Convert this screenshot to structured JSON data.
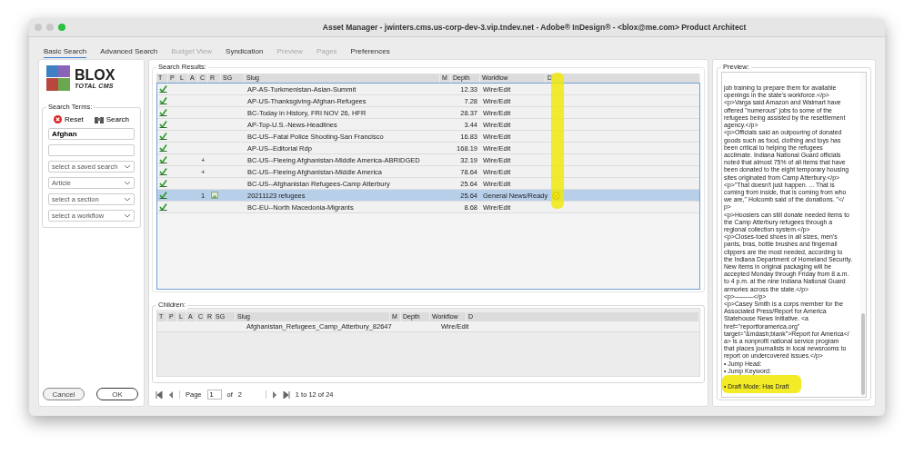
{
  "window": {
    "title": "Asset Manager - jwinters.cms.us-corp-dev-3.vip.tndev.net - Adobe® InDesign® - <blox@me.com> Product Architect"
  },
  "tabs": [
    {
      "label": "Basic Search",
      "selected": true,
      "disabled": false
    },
    {
      "label": "Advanced Search",
      "selected": false,
      "disabled": false
    },
    {
      "label": "Budget View",
      "selected": false,
      "disabled": true
    },
    {
      "label": "Syndication",
      "selected": false,
      "disabled": false
    },
    {
      "label": "Preview",
      "selected": false,
      "disabled": true
    },
    {
      "label": "Pages",
      "selected": false,
      "disabled": true
    },
    {
      "label": "Preferences",
      "selected": false,
      "disabled": false
    }
  ],
  "logo": {
    "name": "BLOX",
    "tagline": "TOTAL CMS"
  },
  "search_terms": {
    "legend": "Search Terms:",
    "reset": "Reset",
    "search": "Search",
    "keyword": "Afghan",
    "selects": [
      "select a saved search",
      "Article",
      "select a section",
      "select a workflow"
    ]
  },
  "results": {
    "legend": "Search Results:",
    "columns": [
      "T",
      "P",
      "L",
      "A",
      "C",
      "R",
      "SG",
      "Slug",
      "M",
      "Depth",
      "Workflow",
      "D"
    ],
    "rows": [
      {
        "slug": "AP-AS-Turkmenistan-Asian-Summit",
        "c": "",
        "r_icon": false,
        "depth": "12.33",
        "workflow": "Wire/Edit",
        "d_icon": false,
        "selected": false
      },
      {
        "slug": "AP-US-Thanksgiving-Afghan-Refugees",
        "c": "",
        "r_icon": false,
        "depth": "7.28",
        "workflow": "Wire/Edit",
        "d_icon": false,
        "selected": false
      },
      {
        "slug": "BC-Today in History, FRI NOV 26, HFR",
        "c": "",
        "r_icon": false,
        "depth": "28.37",
        "workflow": "Wire/Edit",
        "d_icon": false,
        "selected": false
      },
      {
        "slug": "AP-Top-U.S.-News-Headlines",
        "c": "",
        "r_icon": false,
        "depth": "3.44",
        "workflow": "Wire/Edit",
        "d_icon": false,
        "selected": false
      },
      {
        "slug": "BC-US--Fatal Police Shooting-San Francisco",
        "c": "",
        "r_icon": false,
        "depth": "16.83",
        "workflow": "Wire/Edit",
        "d_icon": false,
        "selected": false
      },
      {
        "slug": "AP-US--Editorial Rdp",
        "c": "",
        "r_icon": false,
        "depth": "168.19",
        "workflow": "Wire/Edit",
        "d_icon": false,
        "selected": false
      },
      {
        "slug": "BC-US--Fleeing Afghanistan-Middle America-ABRIDGED",
        "c": "+",
        "r_icon": false,
        "depth": "32.19",
        "workflow": "Wire/Edit",
        "d_icon": false,
        "selected": false
      },
      {
        "slug": "BC-US--Fleeing Afghanistan-Middle America",
        "c": "+",
        "r_icon": false,
        "depth": "78.64",
        "workflow": "Wire/Edit",
        "d_icon": false,
        "selected": false
      },
      {
        "slug": "BC-US--Afghanistan Refugees-Camp Atterbury",
        "c": "",
        "r_icon": false,
        "depth": "25.64",
        "workflow": "Wire/Edit",
        "d_icon": false,
        "selected": false
      },
      {
        "slug": "20211123 refugees",
        "c": "1",
        "r_icon": true,
        "depth": "25.64",
        "workflow": "General News/Ready",
        "d_icon": true,
        "selected": true
      },
      {
        "slug": "BC-EU--North Macedonia-Migrants",
        "c": "",
        "r_icon": false,
        "depth": "8.68",
        "workflow": "Wire/Edit",
        "d_icon": false,
        "selected": false
      }
    ]
  },
  "children": {
    "legend": "Children:",
    "columns": [
      "T",
      "P",
      "L",
      "A",
      "C",
      "R",
      "SG",
      "Slug",
      "M",
      "Depth",
      "Workflow",
      "D"
    ],
    "rows": [
      {
        "slug": "Afghanistan_Refugees_Camp_Atterbury_82647",
        "workflow": "Wire/Edit"
      }
    ]
  },
  "pager": {
    "page_label": "Page",
    "page": "1",
    "of_label": "of",
    "pages": "2",
    "summary": "1 to 12 of 24"
  },
  "buttons": {
    "cancel": "Cancel",
    "ok": "OK"
  },
  "preview": {
    "legend": "Preview:",
    "lines": [
      "job training to prepare them for available",
      "openings in the state's workforce.</p>",
      "<p>Varga said Amazon and Walmart have",
      "offered \"numerous\" jobs to some of the",
      "refugees being assisted by the resettlement",
      "agency.</p>",
      "<p>Officials said an outpouring of donated",
      "goods such as food, clothing and toys has",
      "been critical to helping the refugees",
      "acclimate. Indiana National Guard officials",
      "noted that almost 75% of all items that have",
      "been donated to the eight temporary housing",
      "sites originated from Camp Atterbury.</p>",
      "<p>\"That doesn't just happen. ... That is",
      "coming from inside, that is coming from who",
      "we are,\" Holcomb said of the donations. \"</",
      "p>",
      "<p>Hoosiers can still donate needed items to",
      "the Camp Atterbury refugees through a",
      "regional collection system.</p>",
      "<p>Closes-toed shoes in all sizes, men's",
      "pants, bras, bottle brushes and fingernail",
      "clippers are the most needed, according to",
      "the Indiana Department of Homeland Security.",
      "New items in original packaging will be",
      "accepted Monday through Friday from 8 a.m.",
      "to 4 p.m. at the nine Indiana National Guard",
      "armories across the state.</p>",
      "<p>———</p>",
      "<p>Casey Smith is a corps member for the",
      "Associated Press/Report for America",
      "Statehouse News Initiative. <a",
      "href=\"reportforamerica.org\"",
      "target=\"&mdash;blank\">Report for America</",
      "a> is a nonprofit national service program",
      "that places journalists in local newsrooms to",
      "report on undercovered issues.</p>",
      "• Jump Head:",
      "• Jump Keyword:",
      "• Draft Mode: Has Draft"
    ]
  }
}
